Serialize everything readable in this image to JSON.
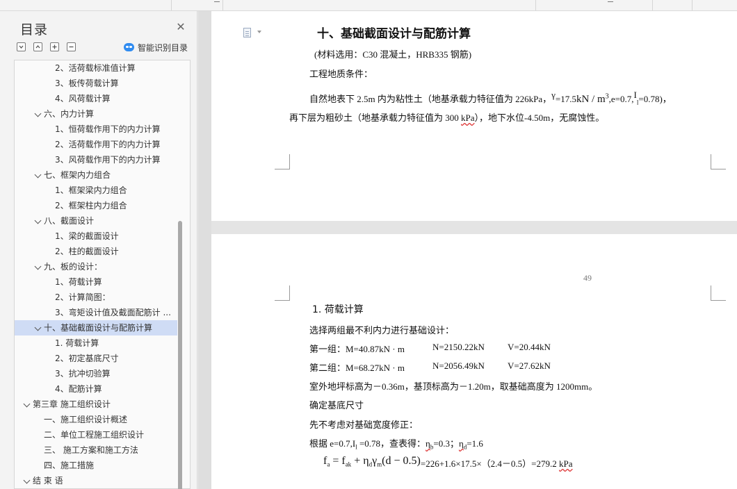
{
  "nav": {
    "title": "目录",
    "smart_toc_label": "智能识别目录",
    "items": [
      {
        "label": "2、活荷载标准值计算",
        "level": 2
      },
      {
        "label": "3、板传荷载计算",
        "level": 2
      },
      {
        "label": "4、风荷载计算",
        "level": 2
      },
      {
        "label": "六、内力计算",
        "level": 1
      },
      {
        "label": "1、恒荷载作用下的内力计算",
        "level": 2
      },
      {
        "label": "2、活荷载作用下的内力计算",
        "level": 2
      },
      {
        "label": "3、风荷载作用下的内力计算",
        "level": 2
      },
      {
        "label": "七、框架内力组合",
        "level": 1
      },
      {
        "label": "1、框架梁内力组合",
        "level": 2
      },
      {
        "label": "2、框架柱内力组合",
        "level": 2
      },
      {
        "label": "八、截面设计",
        "level": 1
      },
      {
        "label": "1、梁的截面设计",
        "level": 2
      },
      {
        "label": "2、柱的截面设计",
        "level": 2
      },
      {
        "label": "九、板的设计：",
        "level": 1
      },
      {
        "label": "1、荷载计算",
        "level": 2
      },
      {
        "label": "2、计算简图：",
        "level": 2
      },
      {
        "label": "3、弯矩设计值及截面配筋计 ...",
        "level": 2
      },
      {
        "label": "十、基础截面设计与配筋计算",
        "level": 1,
        "active": true
      },
      {
        "label": "1. 荷载计算",
        "level": 2
      },
      {
        "label": "2、初定基底尺寸",
        "level": 2
      },
      {
        "label": "3、抗冲切验算",
        "level": 2
      },
      {
        "label": "4、配筋计算",
        "level": 2
      },
      {
        "label": "第三章    施工组织设计",
        "level": 0
      },
      {
        "label": "一、施工组织设计概述",
        "level": 1
      },
      {
        "label": "二、单位工程施工组织设计",
        "level": 1
      },
      {
        "label": "三、  施工方案和施工方法",
        "level": 1
      },
      {
        "label": "四、施工措施",
        "level": 1
      },
      {
        "label": "结 束 语",
        "level": 0
      }
    ]
  },
  "page1": {
    "heading": "十、基础截面设计与配筋计算",
    "materials": "(材料选用：C30 混凝土，HRB335 钢筋)",
    "geo_title": "工程地质条件：",
    "geo_line1_a": "自然地表下 2.5m 内为粘性土（地基承载力特征值为 226kPa，",
    "gamma": "γ",
    "geo_line1_b": "=17.5",
    "unit_kn": "kN / m",
    "unit_exp": "3",
    "geo_line1_c": ",e=0.7,",
    "il": "I",
    "il_sub": "l",
    "geo_line1_d": "=0.78)，",
    "geo_line2_a": "再下层为粗砂土（地基承载力特征值为 300 ",
    "geo_line2_kpa": "kPa",
    "geo_line2_b": "），地下水位-4.50m，无腐蚀性。"
  },
  "page2": {
    "page_number": "49",
    "sub_heading": "1.  荷载计算",
    "line1": "选择两组最不利内力进行基础设计：",
    "g1_label": "第一组：M=40.87kN · m",
    "g1_n": "N=2150.22kN",
    "g1_v": "V=20.44kN",
    "g2_label": "第二组：M=68.27kN · m",
    "g2_n": "N=2056.49kN",
    "g2_v": "V=27.62kN",
    "line_elev": "室外地坪标高为－0.36m，基顶标高为－1.20m，取基础高度为 1200mm。",
    "line_size": "确定基底尺寸",
    "line_width": "先不考虑对基础宽度修正：",
    "line_table_a": "根据 e=0.7,I",
    "line_table_sub": "l",
    "line_table_b": " =0.78，查表得：",
    "eta_b": "η",
    "eta_b_sub": "b",
    "eta_b_val": "=0.3；",
    "eta_d": "η",
    "eta_d_sub": "d",
    "eta_d_val": "=1.6",
    "formula_lhs": "f",
    "formula_lhs_sub": "a",
    "formula_mid": " = f",
    "formula_mid_sub": "ak",
    "formula_plus": " + η",
    "formula_eta_sub": "d",
    "formula_gamma": "γ",
    "formula_gamma_sub": "m",
    "formula_paren": "(d − 0.5)",
    "formula_result": "=226+1.6×17.5×（2.4－0.5）=279.2 ",
    "formula_unit": "kPa"
  }
}
